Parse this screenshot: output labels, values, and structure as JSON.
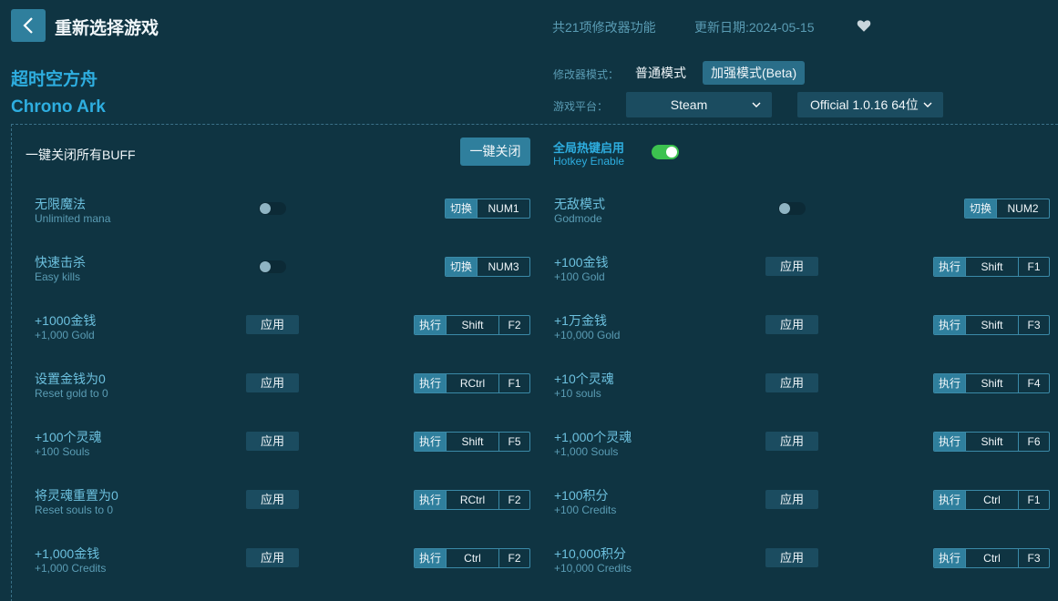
{
  "header": {
    "title": "重新选择游戏",
    "feature_count": "共21项修改器功能",
    "update_date": "更新日期:2024-05-15"
  },
  "game": {
    "name_cn": "超时空方舟",
    "name_en": "Chrono Ark"
  },
  "mode": {
    "label": "修改器模式：",
    "normal": "普通模式",
    "enhanced": "加强模式(Beta)",
    "selected": "加强模式(Beta)"
  },
  "platform": {
    "label": "游戏平台：",
    "value": "Steam",
    "version": "Official 1.0.16 64位"
  },
  "controls": {
    "close_all_label": "一键关闭所有BUFF",
    "close_all_button": "一键关闭",
    "hotkey_cn": "全局热键启用",
    "hotkey_en": "Hotkey Enable",
    "hotkey_enabled": true
  },
  "cheats": [
    {
      "cn": "无限魔法",
      "en": "Unlimited mana",
      "type": "toggle",
      "action": "切换",
      "keys": [
        "NUM1"
      ]
    },
    {
      "cn": "无敌模式",
      "en": "Godmode",
      "type": "toggle",
      "action": "切换",
      "keys": [
        "NUM2"
      ]
    },
    {
      "cn": "快速击杀",
      "en": "Easy kills",
      "type": "toggle",
      "action": "切换",
      "keys": [
        "NUM3"
      ]
    },
    {
      "cn": "+100金钱",
      "en": "+100 Gold",
      "type": "apply",
      "button": "应用",
      "action": "执行",
      "keys": [
        "Shift",
        "F1"
      ]
    },
    {
      "cn": "+1000金钱",
      "en": "+1,000 Gold",
      "type": "apply",
      "button": "应用",
      "action": "执行",
      "keys": [
        "Shift",
        "F2"
      ]
    },
    {
      "cn": "+1万金钱",
      "en": "+10,000 Gold",
      "type": "apply",
      "button": "应用",
      "action": "执行",
      "keys": [
        "Shift",
        "F3"
      ]
    },
    {
      "cn": "设置金钱为0",
      "en": "Reset gold to 0",
      "type": "apply",
      "button": "应用",
      "action": "执行",
      "keys": [
        "RCtrl",
        "F1"
      ]
    },
    {
      "cn": "+10个灵魂",
      "en": "+10 souls",
      "type": "apply",
      "button": "应用",
      "action": "执行",
      "keys": [
        "Shift",
        "F4"
      ]
    },
    {
      "cn": "+100个灵魂",
      "en": "+100 Souls",
      "type": "apply",
      "button": "应用",
      "action": "执行",
      "keys": [
        "Shift",
        "F5"
      ]
    },
    {
      "cn": "+1,000个灵魂",
      "en": "+1,000 Souls",
      "type": "apply",
      "button": "应用",
      "action": "执行",
      "keys": [
        "Shift",
        "F6"
      ]
    },
    {
      "cn": "将灵魂重置为0",
      "en": "Reset souls to 0",
      "type": "apply",
      "button": "应用",
      "action": "执行",
      "keys": [
        "RCtrl",
        "F2"
      ]
    },
    {
      "cn": "+100积分",
      "en": "+100 Credits",
      "type": "apply",
      "button": "应用",
      "action": "执行",
      "keys": [
        "Ctrl",
        "F1"
      ]
    },
    {
      "cn": "+1,000金钱",
      "en": "+1,000 Credits",
      "type": "apply",
      "button": "应用",
      "action": "执行",
      "keys": [
        "Ctrl",
        "F2"
      ]
    },
    {
      "cn": "+10,000积分",
      "en": "+10,000 Credits",
      "type": "apply",
      "button": "应用",
      "action": "执行",
      "keys": [
        "Ctrl",
        "F3"
      ]
    }
  ],
  "colors": {
    "background": "#0f3442",
    "accent": "#2eaee0",
    "button": "#2f7f9d",
    "toggle_on": "#3cc24f"
  }
}
